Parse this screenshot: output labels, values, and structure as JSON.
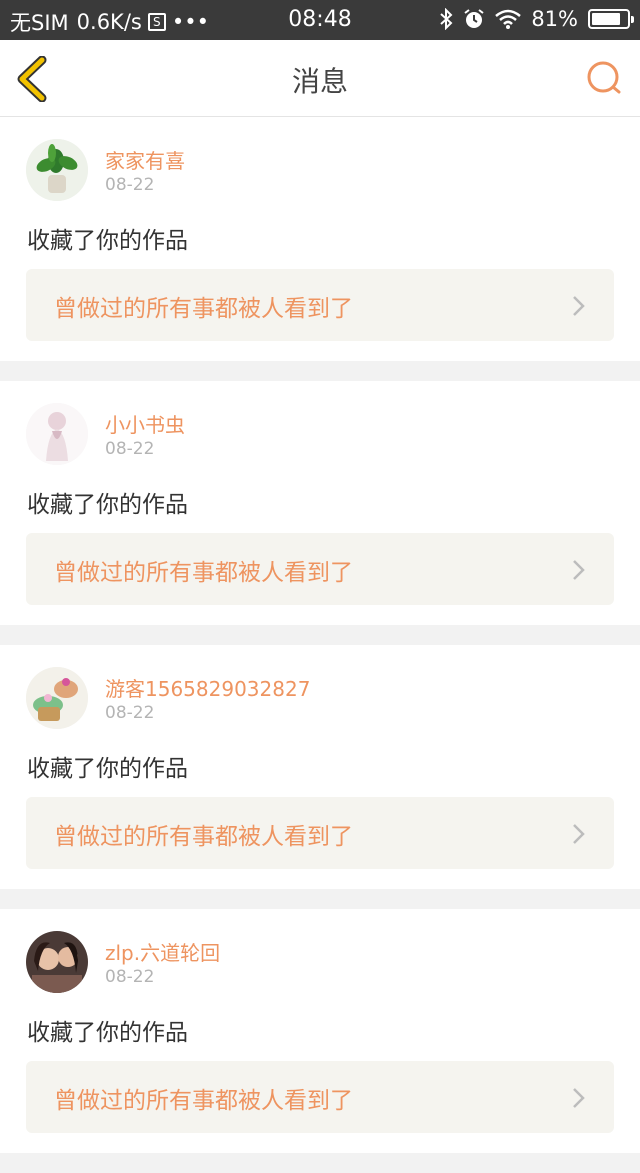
{
  "status_bar": {
    "carrier": "无SIM",
    "speed": "0.6K/s",
    "sim_icon_label": "S",
    "more": "•••",
    "time": "08:48",
    "battery_percent": "81%",
    "battery_level": 0.81
  },
  "header": {
    "title": "消息",
    "back_icon": "back-chevron-icon",
    "search_icon": "search-icon"
  },
  "colors": {
    "accent": "#ee9460",
    "back_icon": "#e6b800",
    "card_link_bg": "#f5f4ef"
  },
  "messages": [
    {
      "username": "家家有喜",
      "date": "08-22",
      "action": "收藏了你的作品",
      "work_title": "曾做过的所有事都被人看到了",
      "avatar": "plant-avatar"
    },
    {
      "username": "小小书虫",
      "date": "08-22",
      "action": "收藏了你的作品",
      "work_title": "曾做过的所有事都被人看到了",
      "avatar": "figure-avatar"
    },
    {
      "username": "游客1565829032827",
      "date": "08-22",
      "action": "收藏了你的作品",
      "work_title": "曾做过的所有事都被人看到了",
      "avatar": "cupcake-avatar"
    },
    {
      "username": "zlp.六道轮回",
      "date": "08-22",
      "action": "收藏了你的作品",
      "work_title": "曾做过的所有事都被人看到了",
      "avatar": "photo-avatar"
    }
  ]
}
